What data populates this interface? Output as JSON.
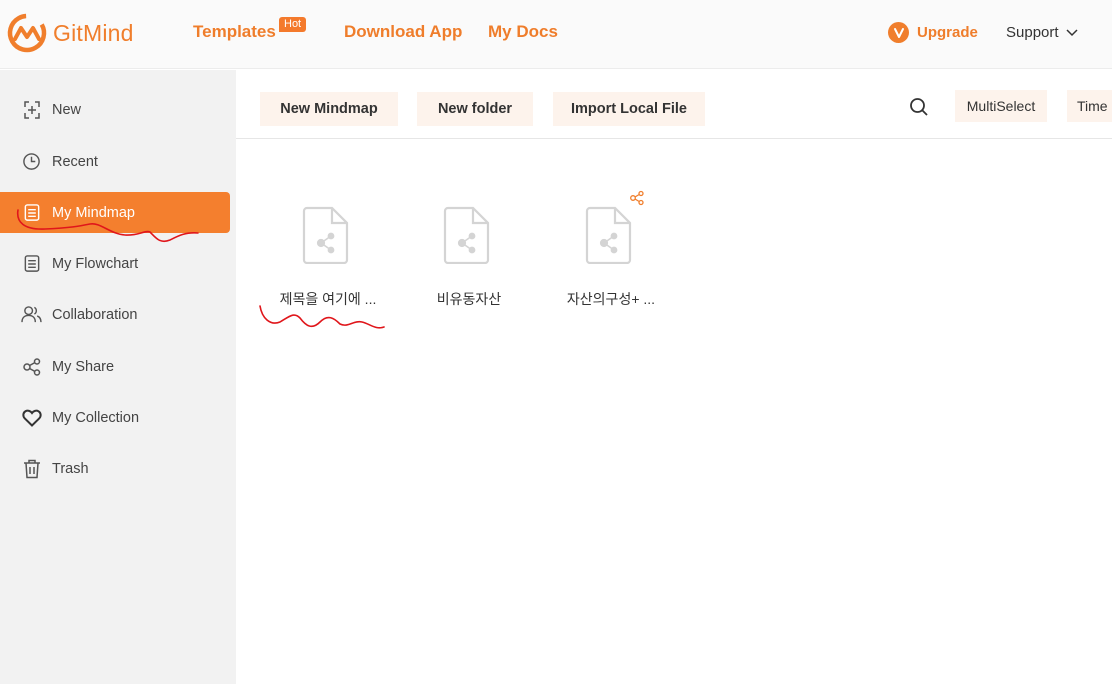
{
  "app": {
    "name": "GitMind"
  },
  "topnav": {
    "templates": "Templates",
    "hot_badge": "Hot",
    "download": "Download App",
    "mydocs": "My Docs",
    "upgrade": "Upgrade",
    "support": "Support"
  },
  "sidebar": {
    "items": [
      {
        "label": "New",
        "icon": "new-icon"
      },
      {
        "label": "Recent",
        "icon": "clock-icon"
      },
      {
        "label": "My Mindmap",
        "icon": "document-icon",
        "active": true
      },
      {
        "label": "My Flowchart",
        "icon": "document-icon"
      },
      {
        "label": "Collaboration",
        "icon": "users-icon"
      },
      {
        "label": "My Share",
        "icon": "share-icon"
      },
      {
        "label": "My Collection",
        "icon": "heart-icon"
      },
      {
        "label": "Trash",
        "icon": "trash-icon"
      }
    ]
  },
  "toolbar": {
    "new_mindmap": "New Mindmap",
    "new_folder": "New folder",
    "import_local": "Import Local File",
    "multiselect": "MultiSelect",
    "sort_time": "Time"
  },
  "files": [
    {
      "name": "제목을 여기에 ...",
      "shared": false
    },
    {
      "name": "비유동자산",
      "shared": false
    },
    {
      "name": "자산의구성+ ...",
      "shared": true
    }
  ],
  "colors": {
    "brand": "#f07e2c",
    "active_bg": "#f47f2e",
    "button_bg": "#fdf3ec",
    "annotation": "#e0161b"
  }
}
